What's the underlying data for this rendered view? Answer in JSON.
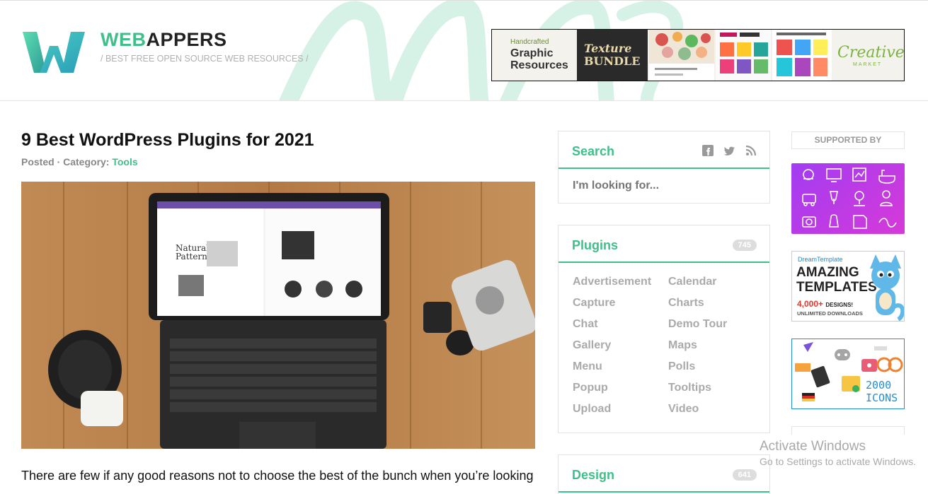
{
  "header": {
    "brand_web": "WEB",
    "brand_appers": "APPERS",
    "tagline": "/ BEST FREE OPEN SOURCE WEB RESOURCES /",
    "ad": {
      "handcrafted": "Handcrafted",
      "graphic_line1": "Graphic",
      "graphic_line2": "Resources",
      "texture_line1": "Texture",
      "texture_line2": "BUNDLE",
      "market_name": "Creative",
      "market_sub": "MARKET"
    }
  },
  "article": {
    "title": "9 Best WordPress Plugins for 2021",
    "meta_prefix": "Posted · Category:",
    "category": "Tools",
    "intro": "There are few if any good reasons not to choose the best of the bunch when you’re looking",
    "hero_screen_text_1": "Natural",
    "hero_screen_text_2": "Patterns."
  },
  "search_widget": {
    "title": "Search",
    "placeholder": "I'm looking for..."
  },
  "plugins_widget": {
    "title": "Plugins",
    "count": "745",
    "left_tags": [
      "Advertisement",
      "Capture",
      "Chat",
      "Gallery",
      "Menu",
      "Popup",
      "Upload"
    ],
    "right_tags": [
      "Calendar",
      "Charts",
      "Demo Tour",
      "Maps",
      "Polls",
      "Tooltips",
      "Video"
    ]
  },
  "design_widget": {
    "title": "Design",
    "count": "641"
  },
  "sidebar": {
    "supported_by": "SUPPORTED BY",
    "dream": {
      "brand": "DreamTemplate",
      "headline_1": "AMAZING",
      "headline_2": "TEMPLATES",
      "designs_count": "4,000+",
      "designs_label": "DESIGNS!",
      "unlimited": "UNLIMITED DOWNLOADS"
    },
    "icons_ad": {
      "count": "2000",
      "label": "ICONS"
    }
  },
  "os_overlay": {
    "title": "Activate Windows",
    "subtitle": "Go to Settings to activate Windows."
  },
  "colors": {
    "accent": "#3fbf8a",
    "muted_text": "#aaaaaa",
    "purple_ad": "#b43be6"
  }
}
